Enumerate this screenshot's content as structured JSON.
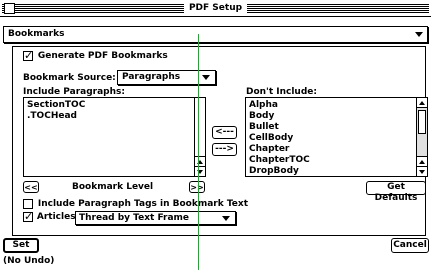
{
  "window": {
    "title": "PDF Setup"
  },
  "section_popup": {
    "selected": "Bookmarks"
  },
  "generate_bookmarks": {
    "label": "Generate PDF Bookmarks",
    "checked": true
  },
  "bookmark_source": {
    "label": "Bookmark Source:",
    "selected": "Paragraphs"
  },
  "include": {
    "label": "Include Paragraphs:",
    "items": [
      "SectionTOC",
      ".TOCHead"
    ]
  },
  "move_buttons": {
    "left": "<---",
    "right": "--->"
  },
  "dont_include": {
    "label": "Don't Include:",
    "items": [
      "Alpha",
      "Body",
      "Bullet",
      "CellBody",
      "Chapter",
      "ChapterTOC",
      "DropBody"
    ]
  },
  "bookmark_level": {
    "label": "Bookmark Level",
    "decrease": "<<",
    "increase": ">>"
  },
  "get_defaults": {
    "label": "Get Defaults"
  },
  "include_tags": {
    "label": "Include Paragraph Tags in Bookmark Text",
    "checked": false
  },
  "articles": {
    "label": "Articles:",
    "checked": true,
    "selected": "Thread by Text Frame"
  },
  "footer": {
    "set_label": "Set",
    "cancel_label": "Cancel",
    "undo_status": "(No Undo)"
  },
  "colors": {
    "guide_line": "#2c9e3a"
  }
}
